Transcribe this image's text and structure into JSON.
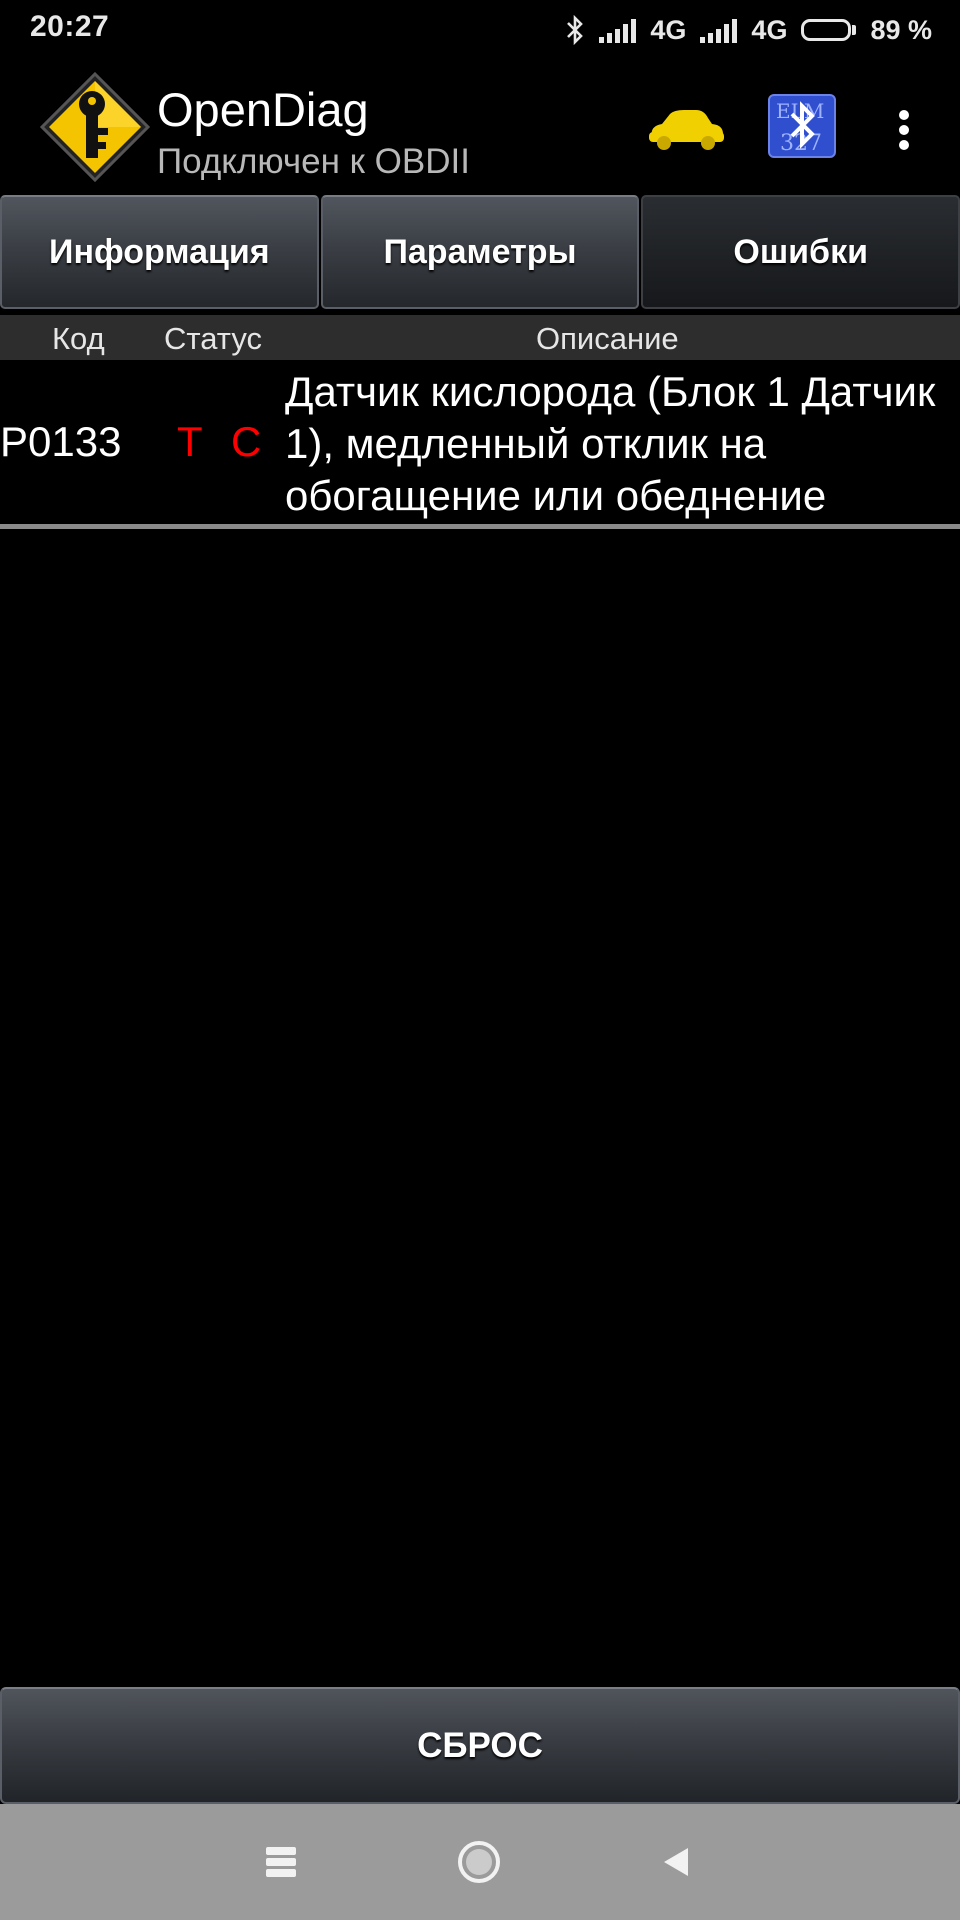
{
  "status_bar": {
    "time": "20:27",
    "network_1": "4G",
    "network_2": "4G",
    "battery": "89 %",
    "battery_level": 0.89,
    "icons": [
      "bluetooth-icon",
      "signal-icon",
      "signal-icon",
      "battery-icon"
    ]
  },
  "app_bar": {
    "title": "OpenDiag",
    "subtitle": "Подключен к OBDII",
    "icons": [
      "app-logo-key-icon",
      "car-icon",
      "elm327-bluetooth-icon",
      "overflow-menu-icon"
    ],
    "colors": {
      "logo_yellow": "#f5c400",
      "car_yellow": "#f0d000",
      "elm_blue": "#2f4fcf"
    }
  },
  "tabs": [
    {
      "label": "Информация",
      "active": false
    },
    {
      "label": "Параметры",
      "active": false
    },
    {
      "label": "Ошибки",
      "active": true
    }
  ],
  "table": {
    "columns": [
      "Код",
      "Статус",
      "Описание"
    ],
    "rows": [
      {
        "code": "P0133",
        "status_flags": [
          "T",
          "C"
        ],
        "description": "Датчик кислорода (Блок 1 Датчик 1), медленный отклик на обогащение или обеднение"
      }
    ],
    "colors": {
      "status_flag": "#ff0000"
    }
  },
  "reset_button": {
    "label": "СБРОС"
  },
  "nav_bar": {
    "icons": [
      "recents-icon",
      "home-icon",
      "back-icon"
    ]
  }
}
